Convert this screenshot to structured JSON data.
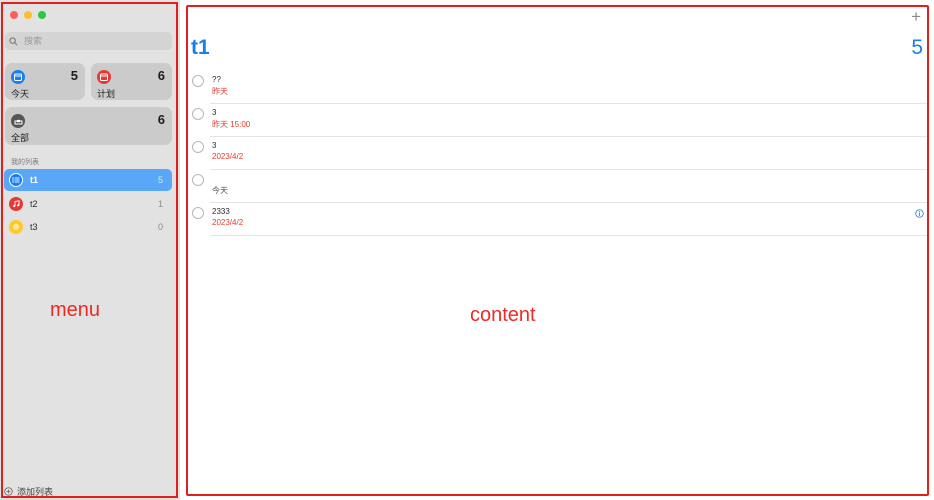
{
  "sidebar": {
    "search_placeholder": "搜索",
    "smart_lists": {
      "today": {
        "label": "今天",
        "count": "5",
        "color": "#1a7ef0",
        "icon": "calendar-today-icon"
      },
      "scheduled": {
        "label": "计划",
        "count": "6",
        "color": "#e53935",
        "icon": "calendar-scheduled-icon"
      },
      "all": {
        "label": "全部",
        "count": "6",
        "color": "#555555",
        "icon": "tray-icon"
      }
    },
    "section_title": "我的列表",
    "lists": [
      {
        "name": "t1",
        "count": "5",
        "color": "#1a7ef0",
        "icon": "list-bullet-icon",
        "active": true
      },
      {
        "name": "t2",
        "count": "1",
        "color": "#e53935",
        "icon": "music-note-icon",
        "active": false
      },
      {
        "name": "t3",
        "count": "0",
        "color": "#ffc928",
        "icon": "circle-icon",
        "active": false
      }
    ],
    "add_list_label": "添加列表",
    "annotation_label": "menu"
  },
  "content": {
    "title": "t1",
    "count": "5",
    "add_button": "+",
    "reminders": [
      {
        "title": "??",
        "date": "昨天",
        "date_style": "red"
      },
      {
        "title": "3",
        "date": "昨天 15:00",
        "date_style": "red"
      },
      {
        "title": "3",
        "date": "2023/4/2",
        "date_style": "red"
      },
      {
        "title": "",
        "date": "今天",
        "date_style": "gray"
      },
      {
        "title": "2333",
        "date": "2023/4/2",
        "date_style": "red",
        "has_info": true
      }
    ],
    "annotation_label": "content"
  },
  "colors": {
    "accent": "#1a7ef0",
    "overdue": "#e53c2f",
    "annotation": "#e0201e"
  }
}
